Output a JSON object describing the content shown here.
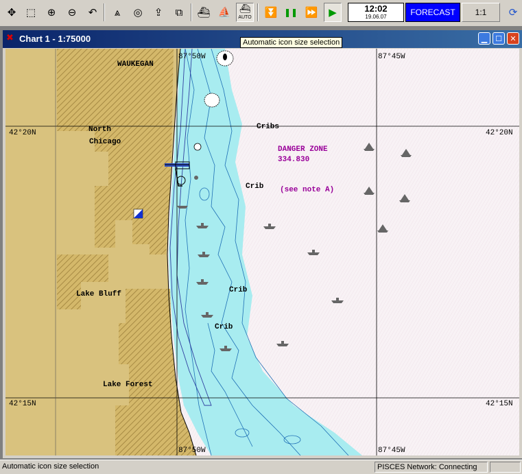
{
  "toolbar": {
    "buttons": [
      {
        "id": "zoom-fit",
        "glyph": "✥"
      },
      {
        "id": "zoom-window",
        "glyph": "⬚"
      },
      {
        "id": "zoom-in",
        "glyph": "⊕"
      },
      {
        "id": "zoom-out",
        "glyph": "⊖"
      },
      {
        "id": "undo-zoom",
        "glyph": "↶"
      },
      {
        "id": "compass",
        "glyph": "⩓"
      },
      {
        "id": "target",
        "glyph": "◎"
      },
      {
        "id": "upload",
        "glyph": "⇪"
      },
      {
        "id": "chart-load",
        "glyph": "⧉"
      },
      {
        "id": "ship-large",
        "glyph": "⛴"
      },
      {
        "id": "ship-small",
        "glyph": "⛵"
      },
      {
        "id": "auto-size",
        "glyph": "⛴"
      },
      {
        "id": "step-down",
        "glyph": "⏬"
      },
      {
        "id": "pause",
        "glyph": "❚❚"
      },
      {
        "id": "fast-forward",
        "glyph": "⏩"
      },
      {
        "id": "play",
        "glyph": "▶"
      }
    ],
    "auto_label": "AUTO",
    "clock_time": "12:02",
    "clock_date": "19.06.07",
    "forecast_label": "FORECAST",
    "scale_label": "1:1"
  },
  "window": {
    "title": "Chart 1 - 1:75000",
    "min_glyph": "▁",
    "max_glyph": "☐",
    "close_glyph": "✕"
  },
  "tooltip": "Automatic icon size selection",
  "chart": {
    "lon_labels": [
      "87°50W",
      "87°45W"
    ],
    "lat_labels": [
      "42°20N",
      "42°15N"
    ],
    "places": [
      "WAUKEGAN",
      "North",
      "Chicago",
      "Lake Bluff",
      "Lake Forest"
    ],
    "cribs": [
      "Cribs",
      "Crib",
      "Crib",
      "Crib"
    ],
    "danger_zone": [
      "DANGER ZONE",
      "334.830",
      "(see note A)"
    ],
    "colors": {
      "land": "#d9c27e",
      "land_hatch": "#a68a45",
      "shallow": "#a8ecf0",
      "deep": "#f7f0f4",
      "depth_line": "#1e6fb5",
      "danger": "#990099",
      "grid": "#000000"
    }
  },
  "status": {
    "message": "Automatic icon size selection",
    "network": "PISCES Network: Connecting"
  }
}
